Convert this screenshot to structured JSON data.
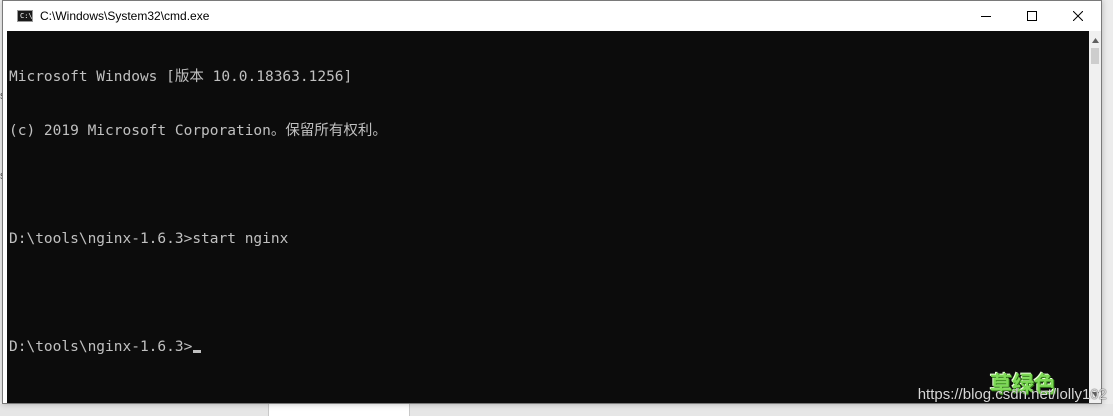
{
  "window": {
    "title": "C:\\Windows\\System32\\cmd.exe",
    "icon": "cmd-icon"
  },
  "controls": {
    "minimize_icon": "minimize-icon",
    "maximize_icon": "maximize-icon",
    "close_icon": "close-icon"
  },
  "console": {
    "lines": [
      "Microsoft Windows [版本 10.0.18363.1256]",
      "(c) 2019 Microsoft Corporation。保留所有权利。",
      "",
      "D:\\tools\\nginx-1.6.3>start nginx",
      "",
      "D:\\tools\\nginx-1.6.3>"
    ],
    "background": "#0c0c0c",
    "foreground": "#c0c0c0"
  },
  "overlay": {
    "logo_text": "草绿色",
    "watermark": "https://blog.csdn.net/lolly102"
  },
  "backdrop": {
    "glyph_1": "s",
    "glyph_2": "s"
  }
}
